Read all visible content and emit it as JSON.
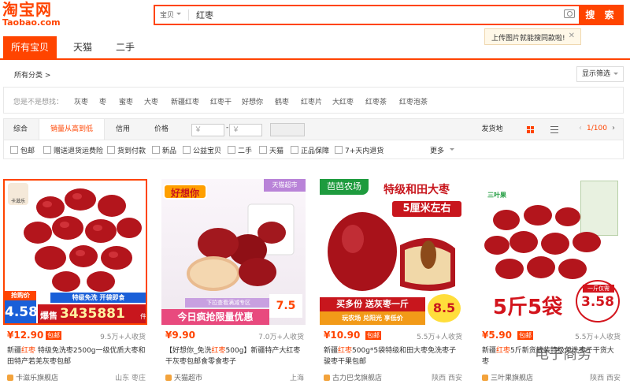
{
  "logo": {
    "cn": "淘宝网",
    "en": "Taobao.com"
  },
  "search": {
    "tab": "宝贝",
    "value": "红枣",
    "button": "搜 索",
    "tooltip": "上传图片就能搜同款啦!"
  },
  "tabs": [
    "所有宝贝",
    "天猫",
    "二手"
  ],
  "category": {
    "label": "所有分类 >",
    "filter": "显示筛选"
  },
  "suggest": {
    "label": "您是不是想找：",
    "items": [
      "灰枣",
      "枣",
      "蜜枣",
      "大枣",
      "新疆红枣",
      "红枣干",
      "好想你",
      "鹤枣",
      "红枣片",
      "大红枣",
      "红枣茶",
      "红枣泡茶"
    ]
  },
  "sort": {
    "items": [
      "综合",
      "销量从高到低",
      "信用",
      "价格"
    ],
    "price_from": "￥",
    "price_to": "￥",
    "ship": "发货地",
    "page": "1/100"
  },
  "options": [
    "包邮",
    "赠送退货运费险",
    "货到付款",
    "新品",
    "公益宝贝",
    "二手",
    "天猫",
    "正品保障",
    "7+天内退货"
  ],
  "more": "更多",
  "products": [
    {
      "price": "¥12.90",
      "free": "包邮",
      "sold": "9.5万+人收货",
      "title_pre": "新疆",
      "title_hl": "红枣",
      "title_post": " 特级免洗枣2500g一级优质大枣和田特产若羌灰枣包邮",
      "shop": "卡滋乐旗舰店",
      "loc": "山东 枣庄",
      "brand": "卡滋乐",
      "promo1": "抢购价",
      "promo2": "4.58",
      "promo3": "特级免洗 开袋即食",
      "promo4": "爆售",
      "promo5": "3435881",
      "promo6": "件"
    },
    {
      "price": "¥9.90",
      "free": "",
      "sold": "7.0万+人收货",
      "title_pre": "【好想你_免洗",
      "title_hl": "红枣",
      "title_post": "500g】新疆特产大红枣干灰枣包邮食零食枣子",
      "shop": "天猫超市",
      "loc": "上海",
      "brand": "好想你",
      "promo1": "天猫超市",
      "promo2": "下拉查看满减专区",
      "promo3": "7.5",
      "promo4": "今日疯抢限量优惠"
    },
    {
      "price": "¥10.90",
      "free": "包邮",
      "sold": "5.5万+人收货",
      "title_pre": "新疆",
      "title_hl": "红枣",
      "title_post": "500g*5袋特级和田大枣免洗枣子骏枣干果包邮",
      "shop": "古力巴戈旗舰店",
      "loc": "陕西 西安",
      "brand": "芭芭农场",
      "promo1": "特级和田大枣",
      "promo2": "5厘米左右",
      "promo3": "买多份 送灰枣一斤",
      "promo4": "8.5",
      "promo5": "玩农场 兑阳光 享低价"
    },
    {
      "price": "¥5.90",
      "free": "包邮",
      "sold": "5.5万+人收货",
      "title_pre": "新疆",
      "title_hl": "红枣",
      "title_post": "5斤新货散装特级免洗枣子干货大枣",
      "shop": "三叶果旗舰店",
      "loc": "陕西 西安",
      "brand": "三叶果",
      "promo1": "5斤5袋",
      "promo2": "3.58",
      "promo3": "一斤仅需",
      "watermark": "电子商务"
    }
  ]
}
